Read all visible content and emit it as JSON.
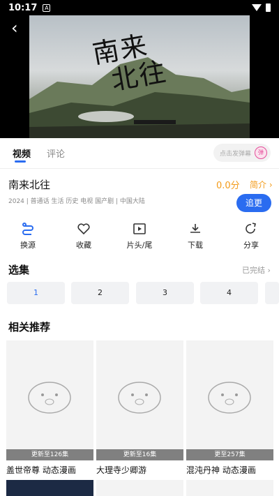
{
  "status_bar": {
    "time": "10:17",
    "notification_badge": "A"
  },
  "player": {
    "title_art_line1": "南来",
    "title_art_line2": "北往",
    "credit_top": "",
    "credit_bottom": ""
  },
  "tabs": [
    {
      "label": "视频",
      "active": true
    },
    {
      "label": "评论",
      "active": false
    }
  ],
  "danmu": {
    "placeholder": "点击发弹幕",
    "icon": "danmaku-icon",
    "icon_glyph": "弹"
  },
  "show": {
    "title": "南来北往",
    "score": "0.0分",
    "intro_label": "简介",
    "meta": "2024 | 普通话 生活 历史 电视 国产剧 | 中国大陆",
    "follow_label": "追更"
  },
  "actions": [
    {
      "label": "换源",
      "icon": "switch-source-icon"
    },
    {
      "label": "收藏",
      "icon": "heart-icon"
    },
    {
      "label": "片头/尾",
      "icon": "play-square-icon"
    },
    {
      "label": "下载",
      "icon": "download-icon"
    },
    {
      "label": "分享",
      "icon": "share-icon"
    }
  ],
  "episodes": {
    "section_title": "选集",
    "status": "已完结",
    "items": [
      "1",
      "2",
      "3",
      "4"
    ],
    "active_index": 0
  },
  "recommend": {
    "section_title": "相关推荐",
    "items": [
      {
        "name": "盖世帝尊 动态漫画",
        "badge": "更新至126集"
      },
      {
        "name": "大理寺少卿游",
        "badge": "更新至16集"
      },
      {
        "name": "混沌丹神 动态漫画",
        "badge": "更至257集"
      }
    ]
  },
  "colors": {
    "accent": "#2a6cf0",
    "score": "#f39b1a",
    "danmu": "#e54e9a"
  }
}
